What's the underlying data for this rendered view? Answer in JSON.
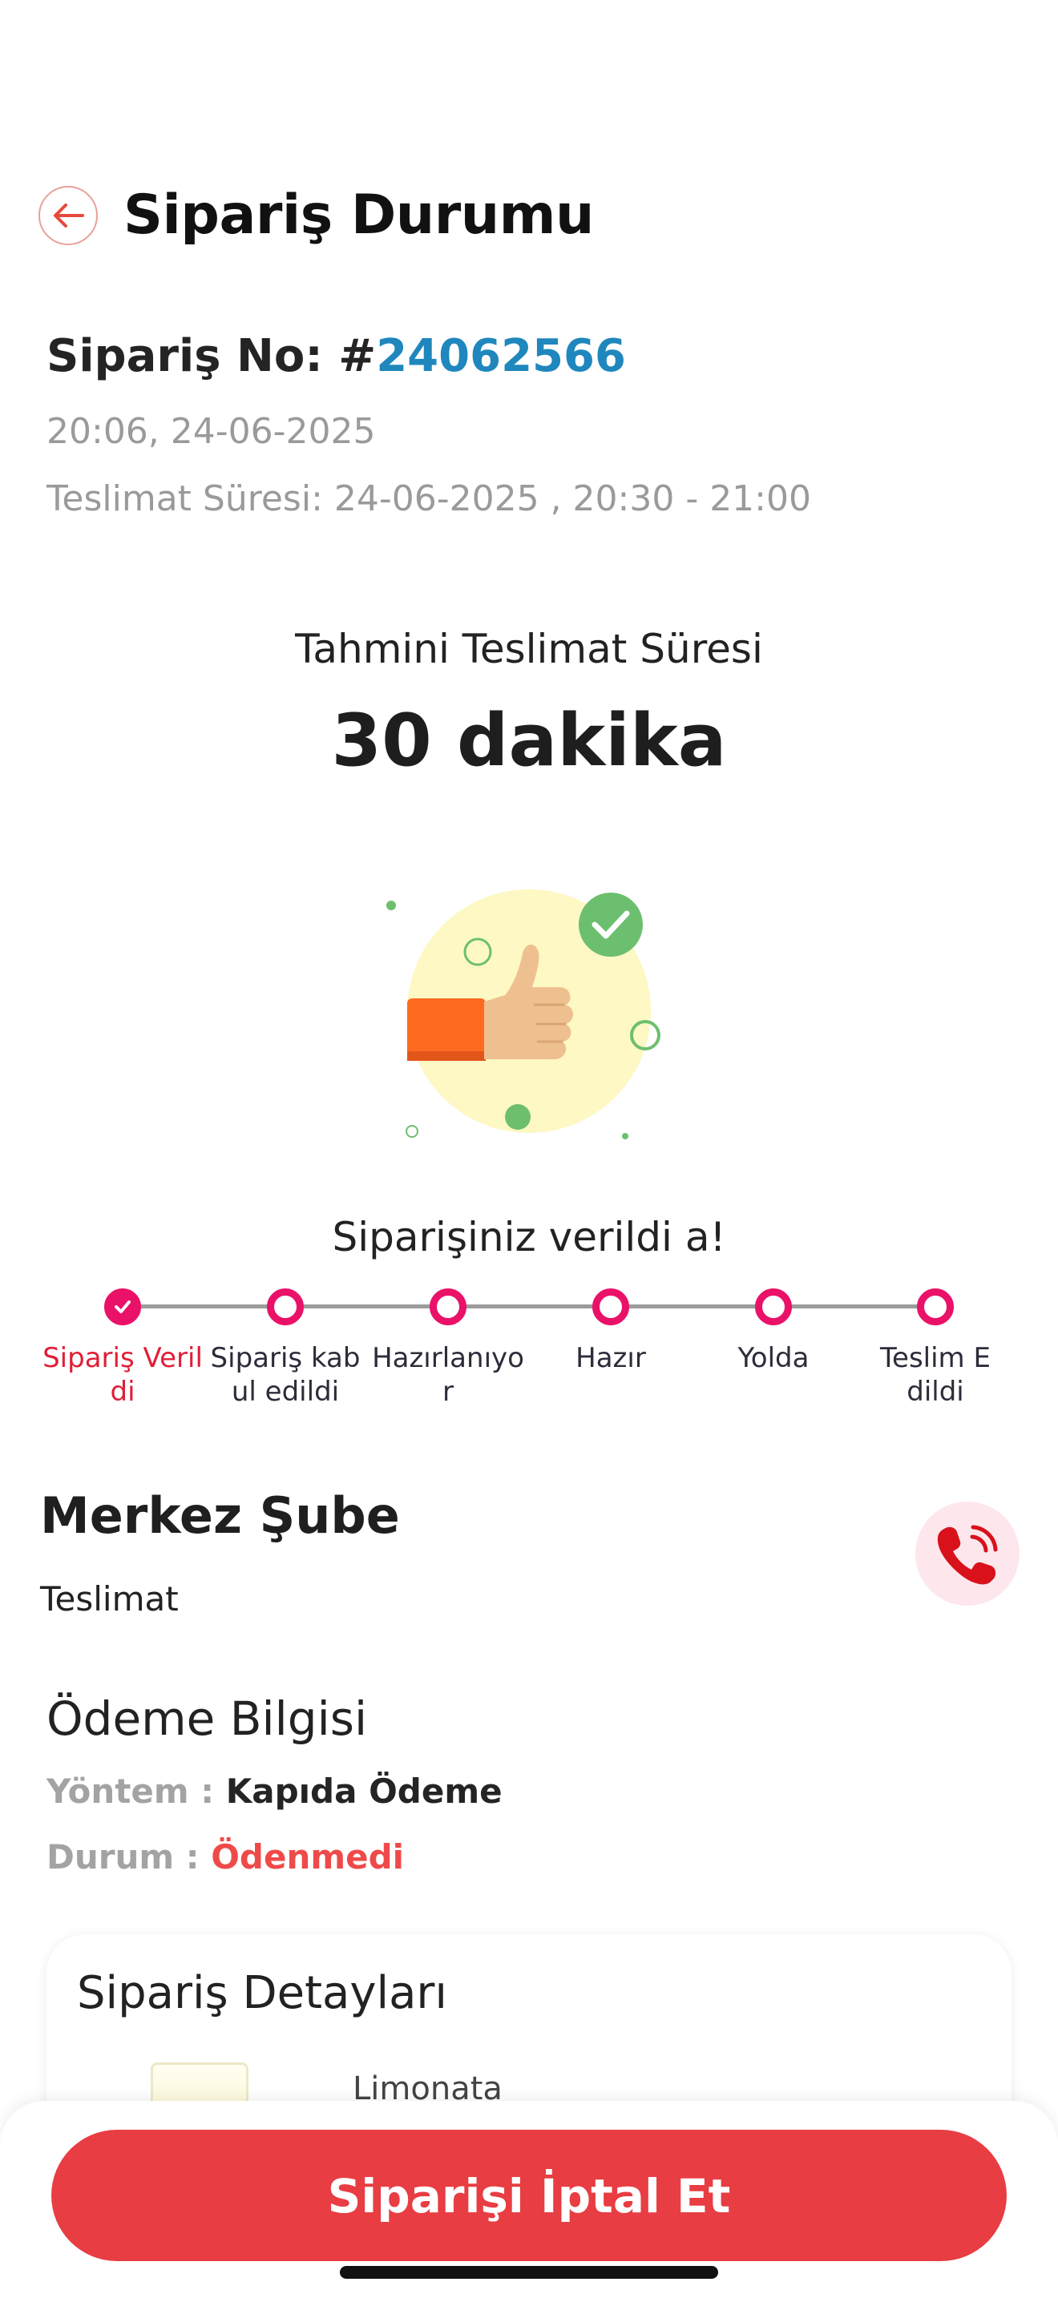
{
  "header": {
    "title": "Sipariş Durumu",
    "back_icon": "arrow-left-icon",
    "accent_color": "#e64a3b"
  },
  "order": {
    "number_label": "Sipariş No: #",
    "number": "24062566",
    "created_at": "20:06, 24-06-2025",
    "delivery_window": "Teslimat Süresi:  24-06-2025 , 20:30 - 21:00"
  },
  "estimate": {
    "label": "Tahmini Teslimat Süresi",
    "value": "30 dakika"
  },
  "status": {
    "message": "Siparişiniz verildi a!",
    "illustration": "thumbs-up-icon",
    "active_color": "#ea1168",
    "steps": [
      {
        "label": "Sipariş Verildi",
        "done": true
      },
      {
        "label": "Sipariş kabul edildi",
        "done": false
      },
      {
        "label": "Hazırlanıyor",
        "done": false
      },
      {
        "label": "Hazır",
        "done": false
      },
      {
        "label": "Yolda",
        "done": false
      },
      {
        "label": "Teslim Edildi",
        "done": false
      }
    ]
  },
  "branch": {
    "name": "Merkez Şube",
    "type": "Teslimat",
    "call_icon": "phone-call-icon"
  },
  "payment": {
    "title": "Ödeme Bilgisi",
    "method_key": "Yöntem : ",
    "method_value": "Kapıda Ödeme",
    "status_key": "Durum : ",
    "status_value": "Ödenmedi",
    "unpaid_color": "#ef4a4a"
  },
  "details": {
    "title": "Sipariş Detayları",
    "items": [
      {
        "name": "Limonata"
      }
    ]
  },
  "actions": {
    "cancel_label": "Siparişi İptal Et",
    "cancel_color": "#e83d42"
  }
}
